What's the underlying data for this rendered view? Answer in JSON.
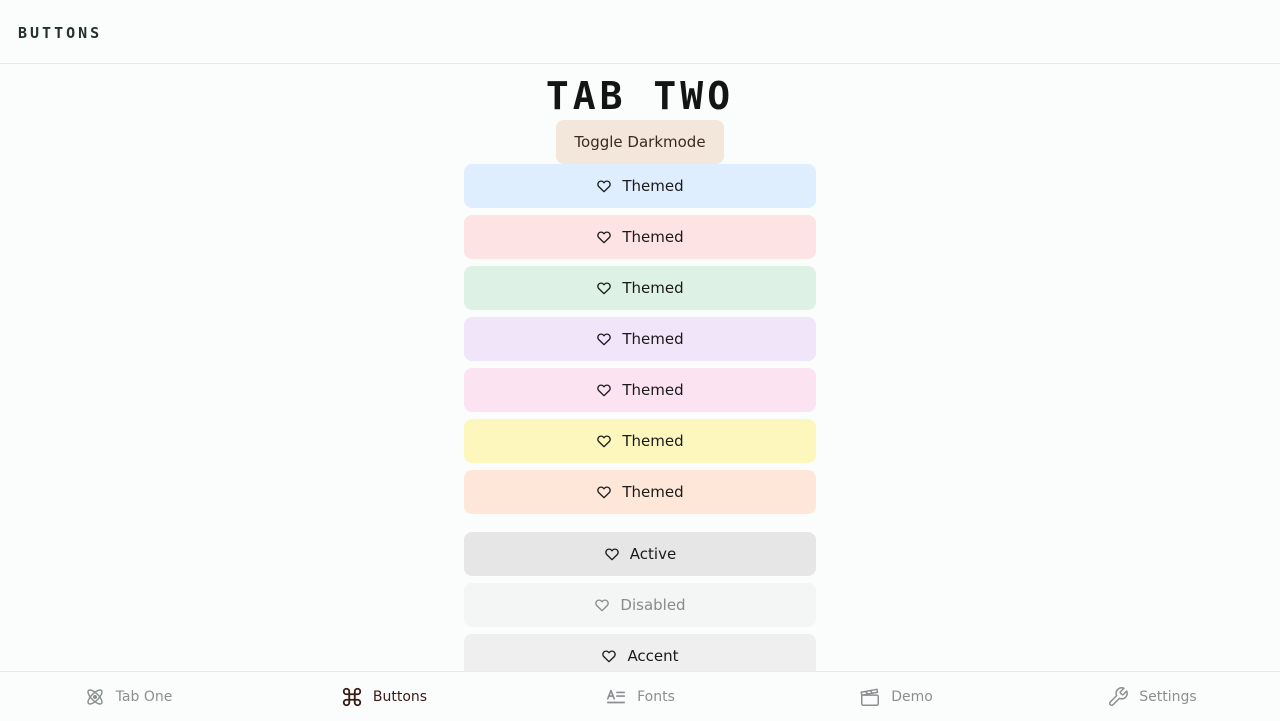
{
  "header": {
    "title": "BUTTONS"
  },
  "page": {
    "title": "TAB TWO",
    "toggle_label": "Toggle Darkmode"
  },
  "buttons": [
    {
      "label": "Themed",
      "icon": "heart-icon",
      "bg": "#dfeefe"
    },
    {
      "label": "Themed",
      "icon": "heart-icon",
      "bg": "#fee3e4"
    },
    {
      "label": "Themed",
      "icon": "heart-icon",
      "bg": "#ddf2e4"
    },
    {
      "label": "Themed",
      "icon": "heart-icon",
      "bg": "#f1e5fa"
    },
    {
      "label": "Themed",
      "icon": "heart-icon",
      "bg": "#fbe3f1"
    },
    {
      "label": "Themed",
      "icon": "heart-icon",
      "bg": "#fef7bd"
    },
    {
      "label": "Themed",
      "icon": "heart-icon",
      "bg": "#fee7d9"
    },
    {
      "label": "Active",
      "icon": "heart-icon",
      "bg": "#e6e6e6"
    },
    {
      "label": "Disabled",
      "icon": "heart-icon",
      "bg": "#f4f5f5"
    },
    {
      "label": "Accent",
      "icon": "heart-icon",
      "bg": "#efefef"
    }
  ],
  "tabs": [
    {
      "label": "Tab One",
      "icon": "atom-icon",
      "active": false
    },
    {
      "label": "Buttons",
      "icon": "command-icon",
      "active": true
    },
    {
      "label": "Fonts",
      "icon": "text-align-icon",
      "active": false
    },
    {
      "label": "Demo",
      "icon": "clapperboard-icon",
      "active": false
    },
    {
      "label": "Settings",
      "icon": "wrench-icon",
      "active": false
    }
  ]
}
